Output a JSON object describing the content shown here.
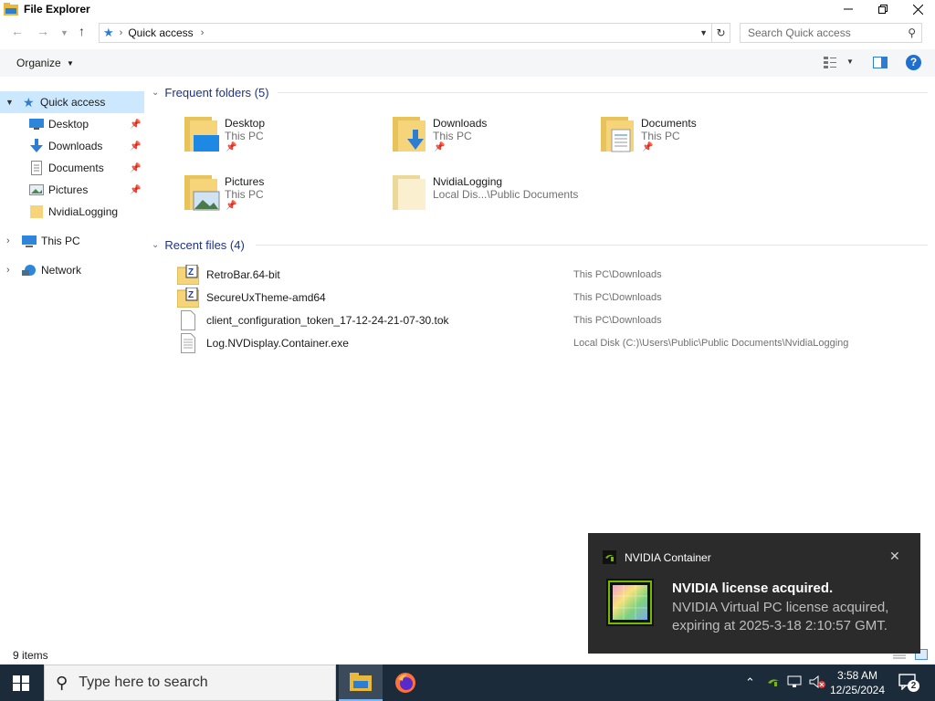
{
  "window": {
    "title": "File Explorer",
    "icon": "file-explorer-icon"
  },
  "address": {
    "crumbs": [
      "Quick access"
    ],
    "search_placeholder": "Search Quick access"
  },
  "commandbar": {
    "organize_label": "Organize"
  },
  "sidebar": {
    "items": [
      {
        "label": "Quick access",
        "icon": "star-icon",
        "selected": true
      },
      {
        "label": "Desktop",
        "icon": "desktop-icon",
        "pinned": true
      },
      {
        "label": "Downloads",
        "icon": "download-icon",
        "pinned": true
      },
      {
        "label": "Documents",
        "icon": "document-icon",
        "pinned": true
      },
      {
        "label": "Pictures",
        "icon": "pictures-icon",
        "pinned": true
      },
      {
        "label": "NvidiaLogging",
        "icon": "folder-icon"
      },
      {
        "label": "This PC",
        "icon": "computer-icon"
      },
      {
        "label": "Network",
        "icon": "network-icon"
      }
    ]
  },
  "frequent": {
    "header": "Frequent folders (5)",
    "folders": [
      {
        "name": "Desktop",
        "location": "This PC",
        "pinned": true
      },
      {
        "name": "Downloads",
        "location": "This PC",
        "pinned": true
      },
      {
        "name": "Documents",
        "location": "This PC",
        "pinned": true
      },
      {
        "name": "Pictures",
        "location": "This PC",
        "pinned": true
      },
      {
        "name": "NvidiaLogging",
        "location": "Local Dis...\\Public Documents",
        "pinned": false
      }
    ]
  },
  "recent": {
    "header": "Recent files (4)",
    "files": [
      {
        "name": "RetroBar.64-bit",
        "location": "This PC\\Downloads",
        "icon": "zip-folder-icon"
      },
      {
        "name": "SecureUxTheme-amd64",
        "location": "This PC\\Downloads",
        "icon": "zip-folder-icon"
      },
      {
        "name": "client_configuration_token_17-12-24-21-07-30.tok",
        "location": "This PC\\Downloads",
        "icon": "blank-file-icon"
      },
      {
        "name": "Log.NVDisplay.Container.exe",
        "location": "Local Disk (C:)\\Users\\Public\\Public Documents\\NvidiaLogging",
        "icon": "text-file-icon"
      }
    ]
  },
  "status": {
    "item_count": "9 items"
  },
  "toast": {
    "app_name": "NVIDIA Container",
    "title": "NVIDIA license acquired.",
    "body": "NVIDIA Virtual PC license acquired, expiring at 2025-3-18 2:10:57 GMT."
  },
  "taskbar": {
    "search_placeholder": "Type here to search",
    "time": "3:58 AM",
    "date": "12/25/2024",
    "notification_count": "2"
  },
  "colors": {
    "accent": "#1e3287",
    "selection": "#cce8ff",
    "taskbar": "#1c2b3a",
    "toast": "#2b2b2b"
  }
}
